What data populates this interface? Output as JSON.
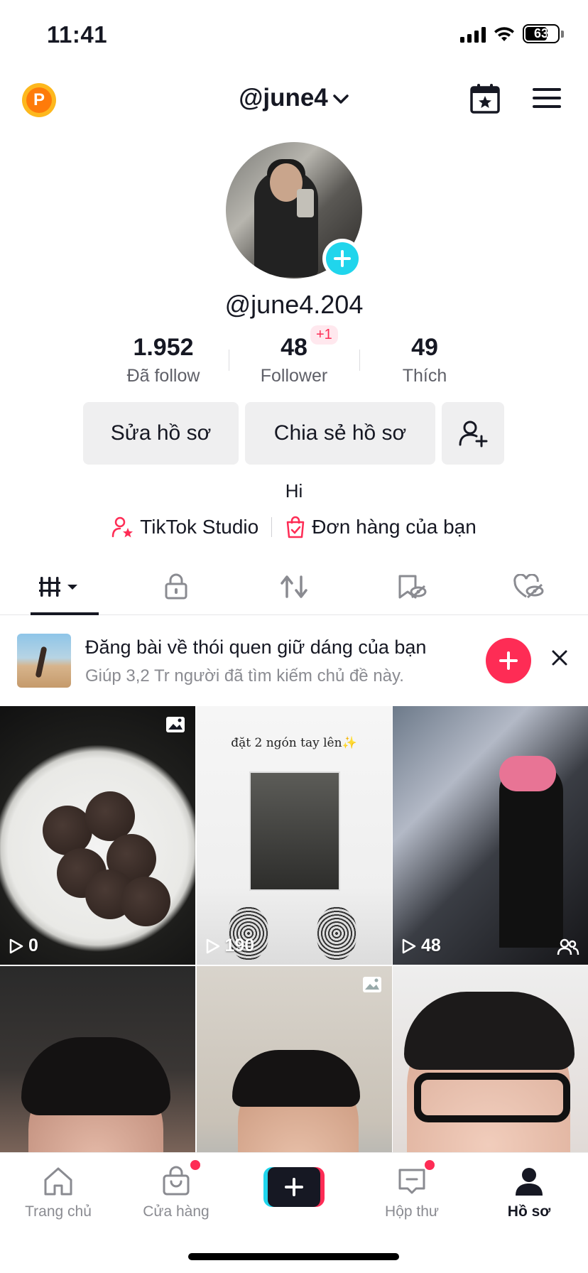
{
  "status_bar": {
    "time": "11:41",
    "battery": "63"
  },
  "header": {
    "username": "@june4"
  },
  "profile": {
    "handle": "@june4.204",
    "stats": [
      {
        "value": "1.952",
        "label": "Đã follow"
      },
      {
        "value": "48",
        "label": "Follower"
      },
      {
        "value": "49",
        "label": "Thích"
      }
    ],
    "follower_delta": "+1",
    "bio": "Hi"
  },
  "actions": {
    "edit": "Sửa hồ sơ",
    "share": "Chia sẻ hồ sơ"
  },
  "links": {
    "studio": "TikTok Studio",
    "orders": "Đơn hàng của bạn"
  },
  "promo": {
    "title": "Đăng bài về thói quen giữ dáng của bạn",
    "subtitle": "Giúp 3,2 Tr người đã tìm kiếm chủ đề này."
  },
  "videos": [
    {
      "views": "0",
      "badge": "photo-icon"
    },
    {
      "views": "190",
      "caption": "đặt 2 ngón tay lên✨"
    },
    {
      "views": "48",
      "badge": "friends-icon"
    },
    {
      "views": ""
    },
    {
      "views": "",
      "badge": "photo-icon"
    },
    {
      "views": ""
    }
  ],
  "nav": [
    {
      "label": "Trang chủ",
      "icon": "home-icon"
    },
    {
      "label": "Cửa hàng",
      "icon": "shop-icon"
    },
    {
      "label": "",
      "icon": "create-icon"
    },
    {
      "label": "Hộp thư",
      "icon": "inbox-icon"
    },
    {
      "label": "Hồ sơ",
      "icon": "profile-icon"
    }
  ],
  "colors": {
    "accent": "#fe2c55",
    "cyan": "#20d5ec",
    "text": "#161823"
  }
}
